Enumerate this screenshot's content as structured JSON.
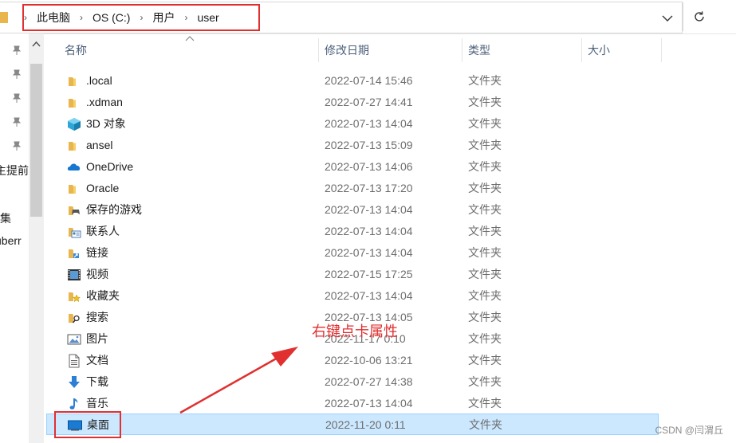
{
  "breadcrumb": {
    "items": [
      "此电脑",
      "OS (C:)",
      "用户",
      "user"
    ]
  },
  "nav": {
    "partial_labels": [
      "主提前",
      "集",
      "uberr"
    ]
  },
  "columns": {
    "name": "名称",
    "date": "修改日期",
    "type": "类型",
    "size": "大小"
  },
  "rows": [
    {
      "name": ".local",
      "date": "2022-07-14 15:46",
      "type": "文件夹",
      "size": "",
      "icon": "folder-icon"
    },
    {
      "name": ".xdman",
      "date": "2022-07-27 14:41",
      "type": "文件夹",
      "size": "",
      "icon": "folder-icon"
    },
    {
      "name": "3D 对象",
      "date": "2022-07-13 14:04",
      "type": "文件夹",
      "size": "",
      "icon": "3d-objects-icon"
    },
    {
      "name": "ansel",
      "date": "2022-07-13 15:09",
      "type": "文件夹",
      "size": "",
      "icon": "folder-icon"
    },
    {
      "name": "OneDrive",
      "date": "2022-07-13 14:06",
      "type": "文件夹",
      "size": "",
      "icon": "onedrive-cloud-icon"
    },
    {
      "name": "Oracle",
      "date": "2022-07-13 17:20",
      "type": "文件夹",
      "size": "",
      "icon": "folder-icon"
    },
    {
      "name": "保存的游戏",
      "date": "2022-07-13 14:04",
      "type": "文件夹",
      "size": "",
      "icon": "saved-games-icon"
    },
    {
      "name": "联系人",
      "date": "2022-07-13 14:04",
      "type": "文件夹",
      "size": "",
      "icon": "contacts-icon"
    },
    {
      "name": "链接",
      "date": "2022-07-13 14:04",
      "type": "文件夹",
      "size": "",
      "icon": "links-icon"
    },
    {
      "name": "视频",
      "date": "2022-07-15 17:25",
      "type": "文件夹",
      "size": "",
      "icon": "videos-icon"
    },
    {
      "name": "收藏夹",
      "date": "2022-07-13 14:04",
      "type": "文件夹",
      "size": "",
      "icon": "favorites-icon"
    },
    {
      "name": "搜索",
      "date": "2022-07-13 14:05",
      "type": "文件夹",
      "size": "",
      "icon": "searches-icon"
    },
    {
      "name": "图片",
      "date": "2022-11-17 0:10",
      "type": "文件夹",
      "size": "",
      "icon": "pictures-icon"
    },
    {
      "name": "文档",
      "date": "2022-10-06 13:21",
      "type": "文件夹",
      "size": "",
      "icon": "documents-icon"
    },
    {
      "name": "下载",
      "date": "2022-07-27 14:38",
      "type": "文件夹",
      "size": "",
      "icon": "downloads-icon"
    },
    {
      "name": "音乐",
      "date": "2022-07-13 14:04",
      "type": "文件夹",
      "size": "",
      "icon": "music-icon"
    },
    {
      "name": "桌面",
      "date": "2022-11-20 0:11",
      "type": "文件夹",
      "size": "",
      "icon": "desktop-icon"
    }
  ],
  "annotation": {
    "text": "右键点卡属性"
  },
  "watermark": "CSDN @闫渭丘",
  "colors": {
    "annotation_red": "#e03030",
    "selection_bg": "#cce8ff",
    "folder_yellow": "#e8b64c"
  }
}
